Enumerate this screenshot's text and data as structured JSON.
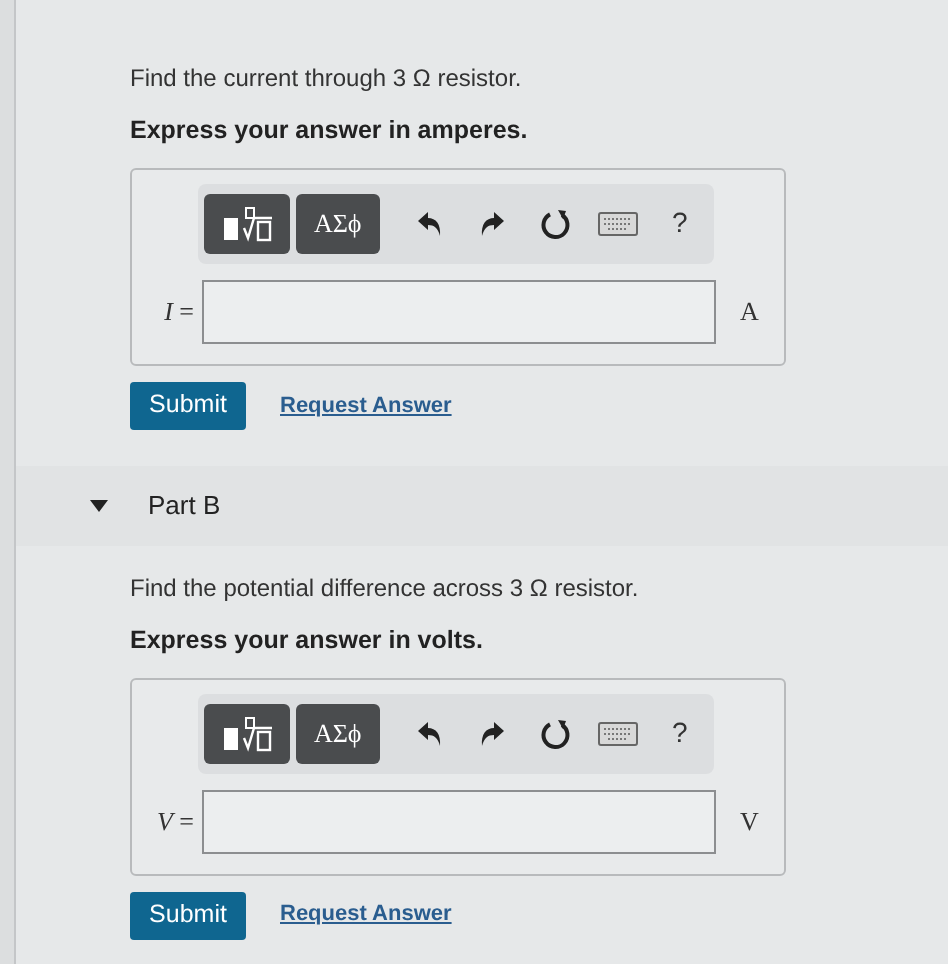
{
  "parts": [
    {
      "prompt": "Find the current through 3 Ω resistor.",
      "instruction": "Express your answer in amperes.",
      "toolbar": {
        "symbols": "ΑΣϕ",
        "help": "?"
      },
      "answer": {
        "variable": "*I* =",
        "unit": "A"
      },
      "submit": "Submit",
      "request": "Request Answer"
    },
    {
      "header": {
        "title": "Part B",
        "expanded": true
      },
      "prompt": "Find the potential difference across 3 Ω resistor.",
      "instruction": "Express your answer in volts.",
      "toolbar": {
        "symbols": "ΑΣϕ",
        "help": "?"
      },
      "answer": {
        "variable": "*V* =",
        "unit": "V"
      },
      "submit": "Submit",
      "request": "Request Answer"
    }
  ]
}
